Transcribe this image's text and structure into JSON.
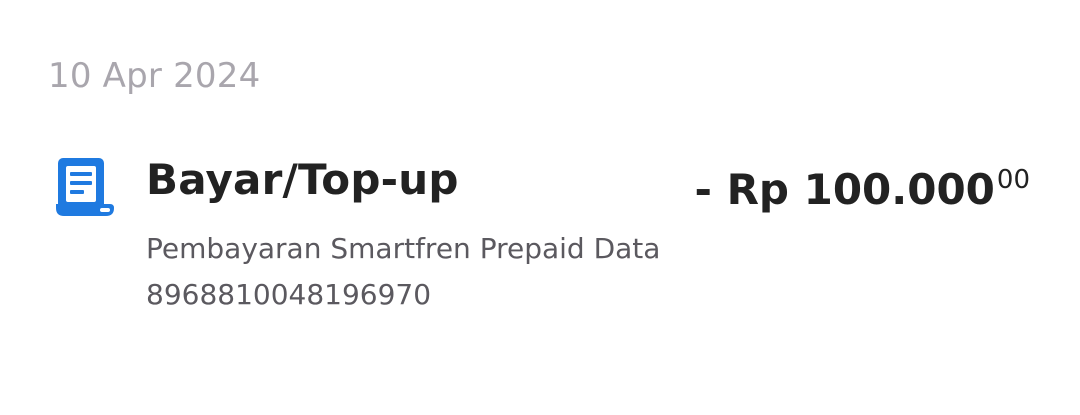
{
  "date_header": "10 Apr 2024",
  "transaction": {
    "icon": "receipt-icon",
    "title": "Bayar/Top-up",
    "amount_main": "- Rp 100.000",
    "amount_cents": "00",
    "description_line1": "Pembayaran Smartfren Prepaid Data",
    "description_line2": "8968810048196970"
  },
  "colors": {
    "icon_blue": "#1f7ae0",
    "date_gray": "#a9a6ad",
    "title_text": "#222222",
    "desc_text": "#5b595f"
  }
}
